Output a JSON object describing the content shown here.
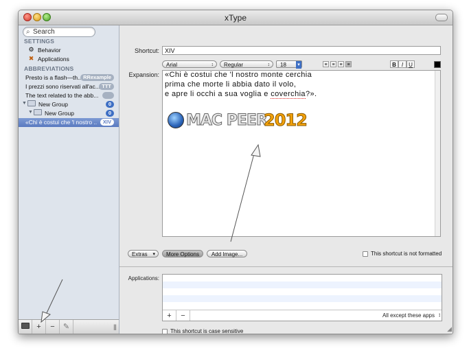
{
  "window": {
    "title": "xType"
  },
  "search": {
    "placeholder": "Search"
  },
  "sidebar": {
    "settings_header": "SETTINGS",
    "settings_items": [
      {
        "label": "Behavior",
        "icon": "gear-icon"
      },
      {
        "label": "Applications",
        "icon": "applications-icon"
      }
    ],
    "abbreviations_header": "ABBREVIATIONS",
    "abbreviations": [
      {
        "label": "Presto is a flash—th...",
        "badge": "RRexample"
      },
      {
        "label": "I prezzi sono riservati all'ac...",
        "badge": "TTT"
      },
      {
        "label": "The text related to the abb...",
        "badge": ""
      },
      {
        "label": "New Group",
        "badge": "0"
      },
      {
        "label": "New Group",
        "badge": "0"
      },
      {
        "label": "«Chi è costui che 'l nostro ...",
        "badge": "XIV"
      }
    ],
    "bottom_buttons": {
      "add": "+",
      "remove": "−",
      "grip": "|||"
    }
  },
  "main": {
    "shortcut_label": "Shortcut:",
    "shortcut_value": "XIV",
    "expansion_label": "Expansion:",
    "font_family": "Arial",
    "font_style": "Regular",
    "font_size": "18",
    "style_bold": "B",
    "style_italic": "I",
    "style_underline": "U",
    "text_color": "#000000",
    "expansion_lines": [
      "«Chi è costui che 'l nostro monte cerchia",
      "prima che morte li abbia dato il volo,",
      "e apre li occhi a sua voglia e "
    ],
    "expansion_misspelled": "coverchia",
    "expansion_tail": "?».",
    "logo_text": "MAC PEER",
    "logo_year": "2012",
    "extras_label": "Extras",
    "more_options_label": "More Options",
    "add_image_label": "Add Image...",
    "not_formatted_label": "This shortcut is not formatted",
    "applications_label": "Applications:",
    "apps_add": "+",
    "apps_remove": "−",
    "apps_scope": "All except these apps",
    "case_sensitive_label": "This shortcut is case sensitive"
  }
}
